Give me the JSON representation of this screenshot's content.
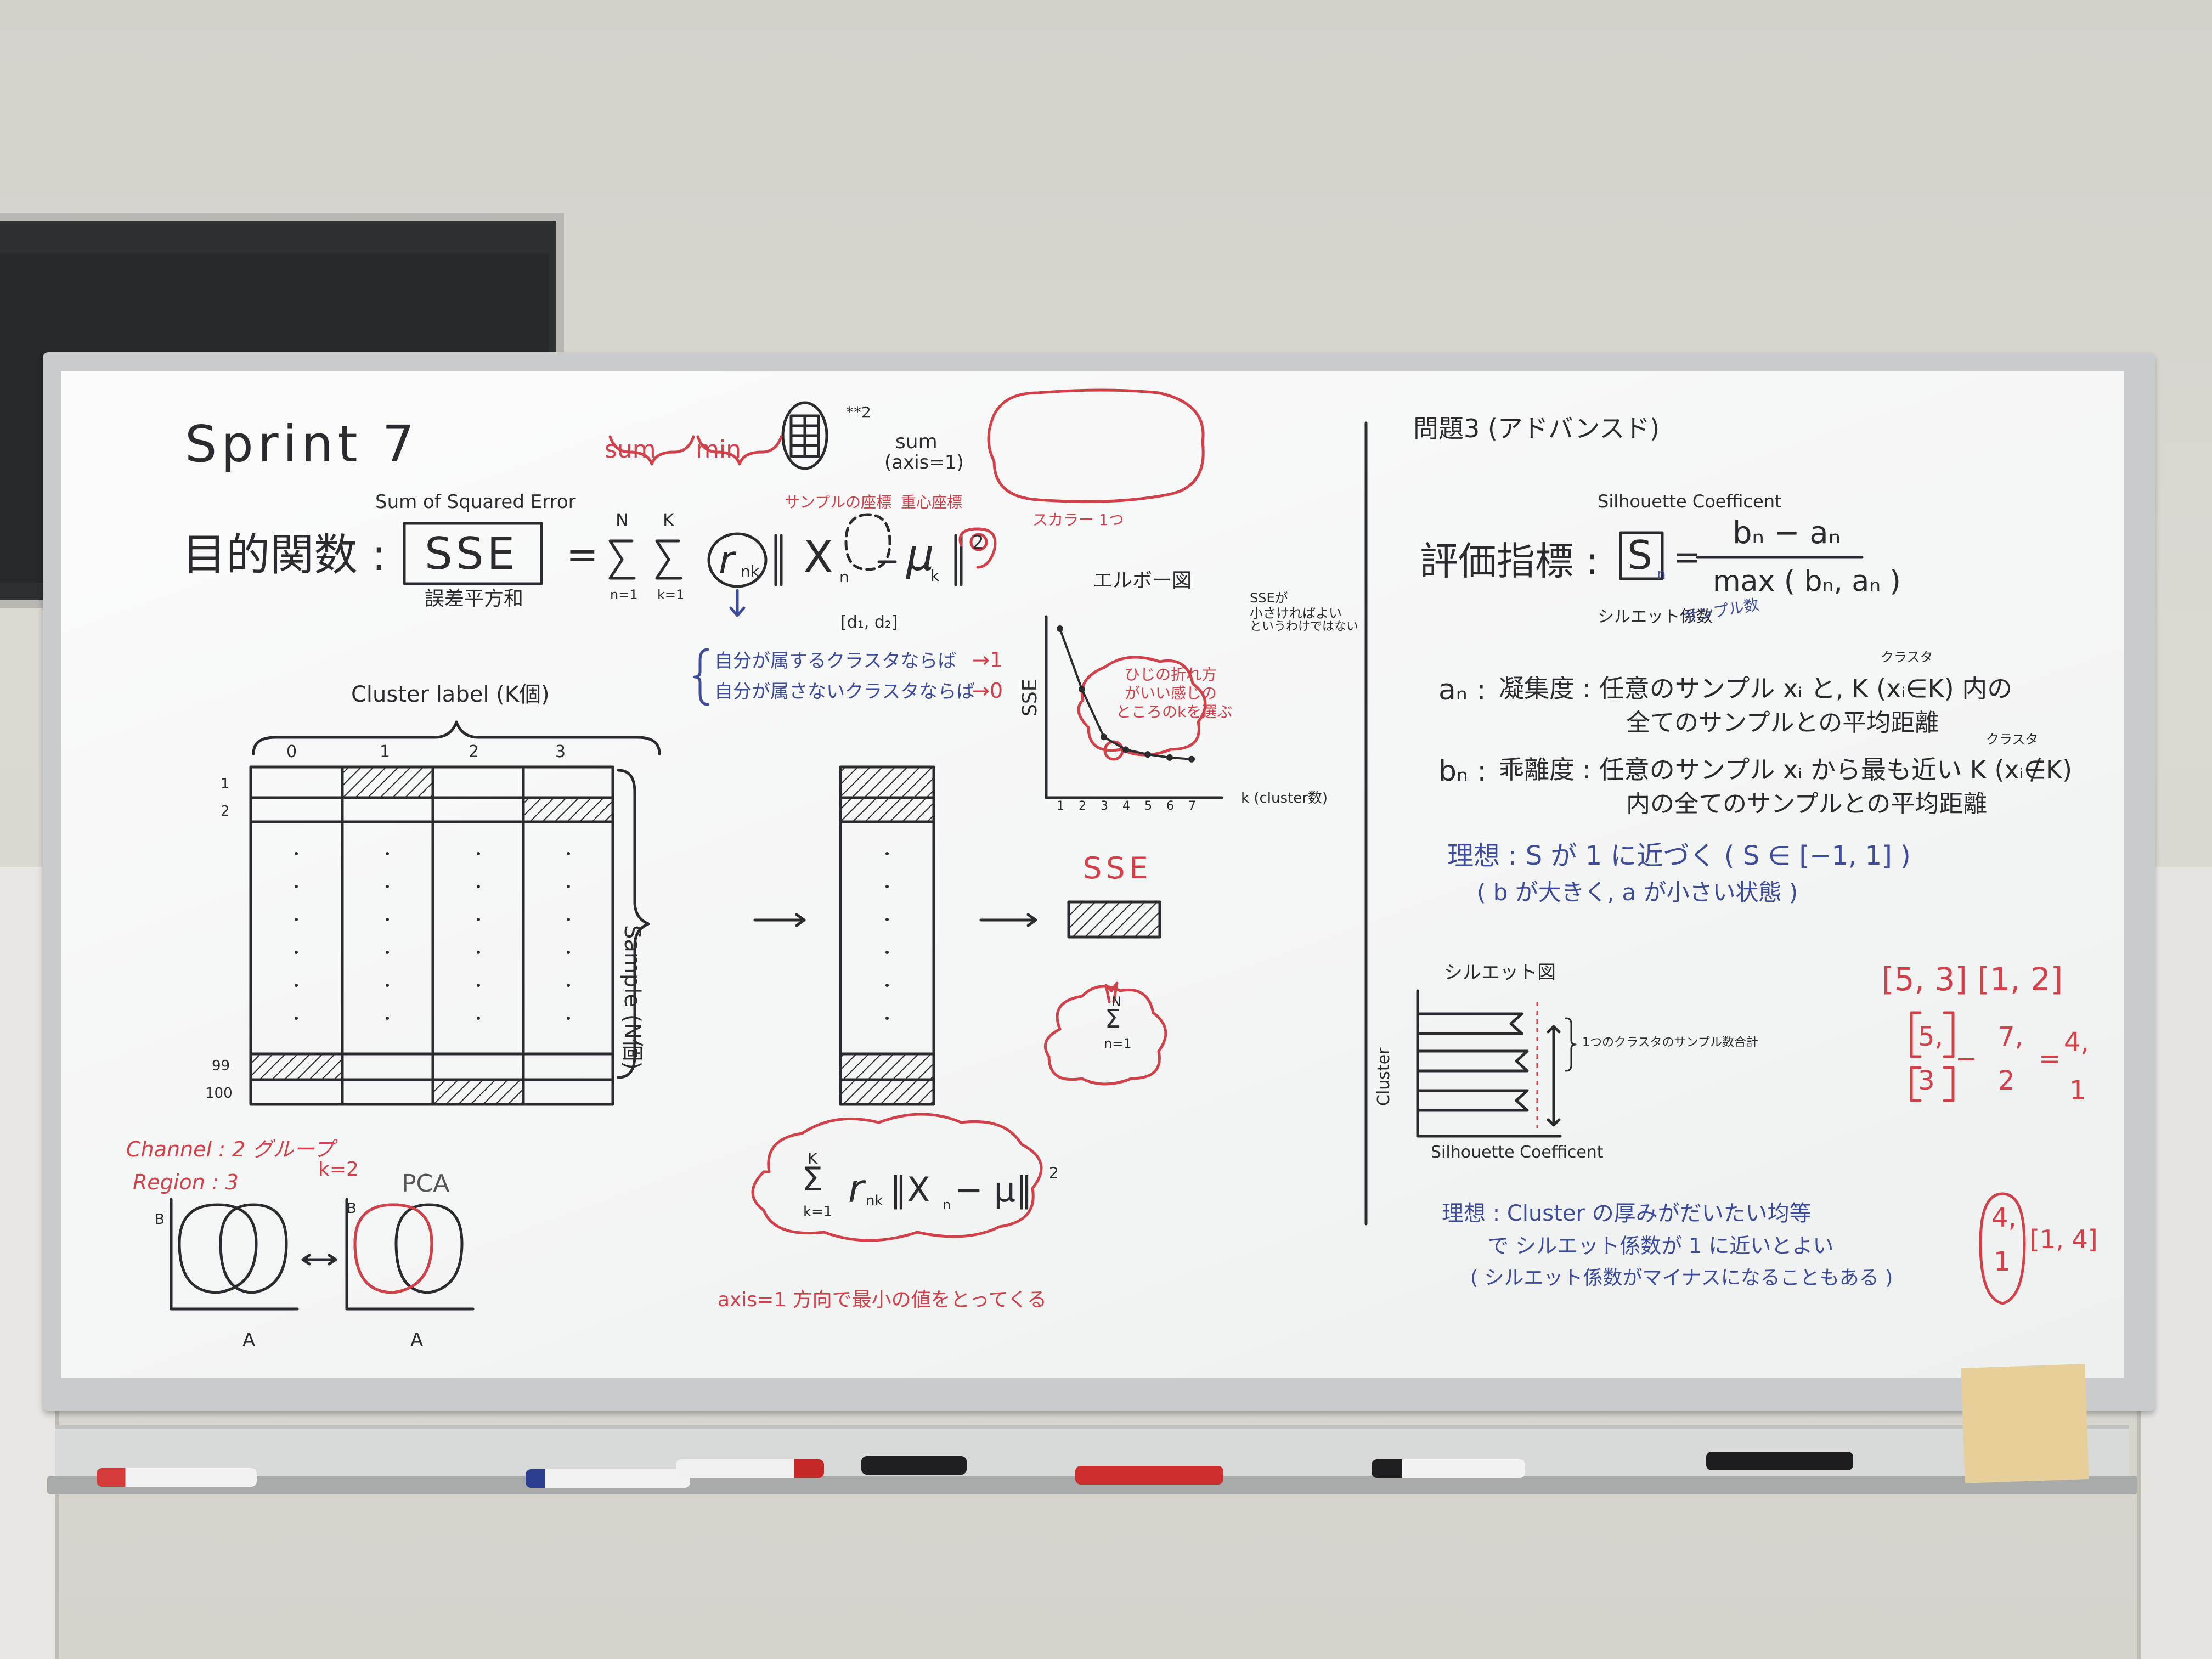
{
  "left": {
    "title": "Sprint 7",
    "objective_label": "目的関数 :",
    "sse_caption": "Sum of Squared Error",
    "sse_box": "SSE",
    "sse_jp": "誤差平方和",
    "sum_label": "sum",
    "min_label": "min",
    "sum_axis_top": "sum",
    "sum_axis_bottom": "(axis=1)",
    "power_note": "**2",
    "sample_coord": "サンプルの座標",
    "centroid_coord": "重心座標",
    "scalar_note": "スカラー 1つ",
    "formula_eq": "=",
    "sum_n_top": "N",
    "sum_n_bottom": "n=1",
    "sum_k_top": "K",
    "sum_k_bottom": "k=1",
    "r_nk": "r",
    "r_sub": "nk",
    "x_n": "X",
    "x_sub": "n",
    "mu_k": "μ",
    "mu_sub": "k",
    "square": "2",
    "dims": "[d₁, d₂]",
    "cond1": "自分が属するクラスタならば",
    "cond1_val": "→1",
    "cond2": "自分が属さないクラスタならば",
    "cond2_val": "→0",
    "cluster_label": "Cluster label (K個)",
    "cols": [
      "0",
      "1",
      "2",
      "3"
    ],
    "rows_top": [
      "1",
      "2"
    ],
    "rows_bottom": [
      "99",
      "100"
    ],
    "sample_label": "Sample (N個)",
    "sse_result": "SSE",
    "bubble_sum_top": "N",
    "bubble_sum_bottom": "n=1",
    "big_formula_top": "K",
    "big_formula_bottom": "k=1",
    "big_r": "r",
    "big_r_sub": "nk",
    "big_norm": "‖X",
    "big_norm_sub": "n",
    "big_minus": "− μ‖",
    "big_sq": "2",
    "axis_note": "axis=1 方向で最小の値をとってくる",
    "channel_note": "Channel : 2 グループ",
    "region_note": "Region : 3",
    "k_note": "k=2",
    "pca_note": "PCA",
    "scatter_b": "B",
    "scatter_b2": "B",
    "scatter_a": "A",
    "scatter_a2": "A"
  },
  "elbow": {
    "title": "エルボー図",
    "ylabel": "SSE",
    "xlabel": "k (cluster数)",
    "xticks": [
      "1",
      "2",
      "3",
      "4",
      "5",
      "6",
      "7"
    ],
    "values": [
      10,
      6.2,
      3.2,
      2.4,
      2.1,
      1.9,
      1.8
    ],
    "note1": "SSEが",
    "note2": "小さければよい",
    "note3": "というわけではない",
    "bubble1": "ひじの折れ方",
    "bubble2": "がいい感じの",
    "bubble3": "ところのkを選ぶ"
  },
  "right": {
    "title": "問題3 (アドバンスド)",
    "silhouette_caption": "Silhouette Coefficent",
    "metric_label": "評価指標 :",
    "s_box": "S",
    "s_sub": "n",
    "eq": "=",
    "numerator": "bₙ − aₙ",
    "denominator": "max ( bₙ, aₙ )",
    "silhouette_jp": "シルエット係数",
    "sample_jp": "サンプル数",
    "a_def_label": "aₙ :",
    "a_def1": "凝集度 : 任意のサンプル xᵢ と, K (xᵢ∈K) 内の",
    "a_def2": "全てのサンプルとの平均距離",
    "cluster_kana": "クラスタ",
    "b_def_label": "bₙ :",
    "b_def1": "乖離度 : 任意のサンプル xᵢ から最も近い K (xᵢ∉K)",
    "b_def2": "内の全てのサンプルとの平均距離",
    "ideal1": "理想 : S が 1 に近づく ( S ∈ [−1, 1] )",
    "ideal2": "( b が大きく, a が小さい状態 )",
    "sil_fig_title": "シルエット図",
    "sil_ylabel": "Cluster",
    "sil_xlabel": "Silhouette Coefficent",
    "sil_note": "1つのクラスタのサンプル数合計",
    "ideal3": "理想 : Cluster の厚みがだいたい均等",
    "ideal4": "で シルエット係数が 1 に近いとよい",
    "ideal5": "( シルエット係数がマイナスになることもある )",
    "red_list": "[5, 3] [1, 2]",
    "red_a": "5,",
    "red_b": "7,",
    "red_c": "3",
    "red_d": "2",
    "red_e": "4,",
    "red_f": "1",
    "red_minus": "−",
    "red_eq": "=",
    "red_g": "4,",
    "red_h": "1",
    "red_i": "[1, 4]"
  }
}
